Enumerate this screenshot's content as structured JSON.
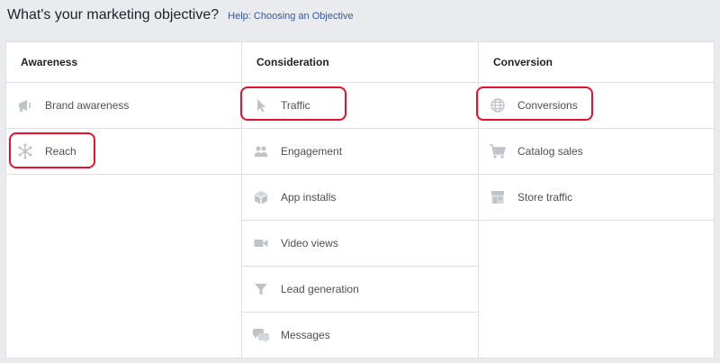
{
  "header": {
    "title": "What's your marketing objective?",
    "help_link": "Help: Choosing an Objective"
  },
  "columns": [
    {
      "heading": "Awareness",
      "items": [
        {
          "label": "Brand awareness",
          "icon": "megaphone-icon"
        },
        {
          "label": "Reach",
          "icon": "reach-icon"
        }
      ]
    },
    {
      "heading": "Consideration",
      "items": [
        {
          "label": "Traffic",
          "icon": "cursor-icon"
        },
        {
          "label": "Engagement",
          "icon": "people-icon"
        },
        {
          "label": "App installs",
          "icon": "box-icon"
        },
        {
          "label": "Video views",
          "icon": "video-camera-icon"
        },
        {
          "label": "Lead generation",
          "icon": "funnel-icon"
        },
        {
          "label": "Messages",
          "icon": "chat-bubbles-icon"
        }
      ]
    },
    {
      "heading": "Conversion",
      "items": [
        {
          "label": "Conversions",
          "icon": "globe-icon"
        },
        {
          "label": "Catalog sales",
          "icon": "shopping-cart-icon"
        },
        {
          "label": "Store traffic",
          "icon": "storefront-icon"
        }
      ]
    }
  ],
  "colors": {
    "icon": "#bec2c9",
    "highlight": "#e8112d",
    "link": "#365899"
  }
}
